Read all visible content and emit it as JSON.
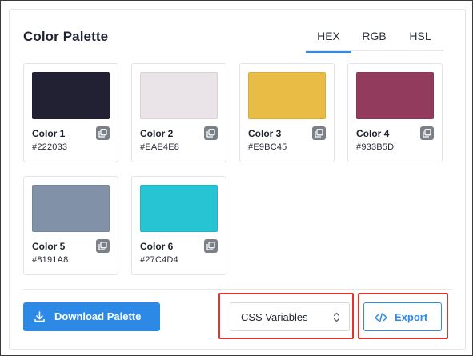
{
  "header": {
    "title": "Color Palette"
  },
  "tabs": [
    {
      "label": "HEX",
      "active": true
    },
    {
      "label": "RGB",
      "active": false
    },
    {
      "label": "HSL",
      "active": false
    }
  ],
  "colors": [
    {
      "name": "Color 1",
      "hex": "#222033",
      "swatch": "#222033"
    },
    {
      "name": "Color 2",
      "hex": "#EAE4E8",
      "swatch": "#EAE4E8"
    },
    {
      "name": "Color 3",
      "hex": "#E9BC45",
      "swatch": "#E9BC45"
    },
    {
      "name": "Color 4",
      "hex": "#933B5D",
      "swatch": "#933B5D"
    },
    {
      "name": "Color 5",
      "hex": "#8191A8",
      "swatch": "#8191A8"
    },
    {
      "name": "Color 6",
      "hex": "#27C4D4",
      "swatch": "#27C4D4"
    }
  ],
  "footer": {
    "download_label": "Download Palette",
    "format_select": {
      "selected": "CSS Variables"
    },
    "export_label": "Export"
  },
  "icons": {
    "copy": "copy-icon",
    "download": "download-icon",
    "chevron": "chevron-updown-icon",
    "code": "code-icon"
  },
  "theme": {
    "accent": "#2C8AE6",
    "highlight": "#E0342C"
  }
}
